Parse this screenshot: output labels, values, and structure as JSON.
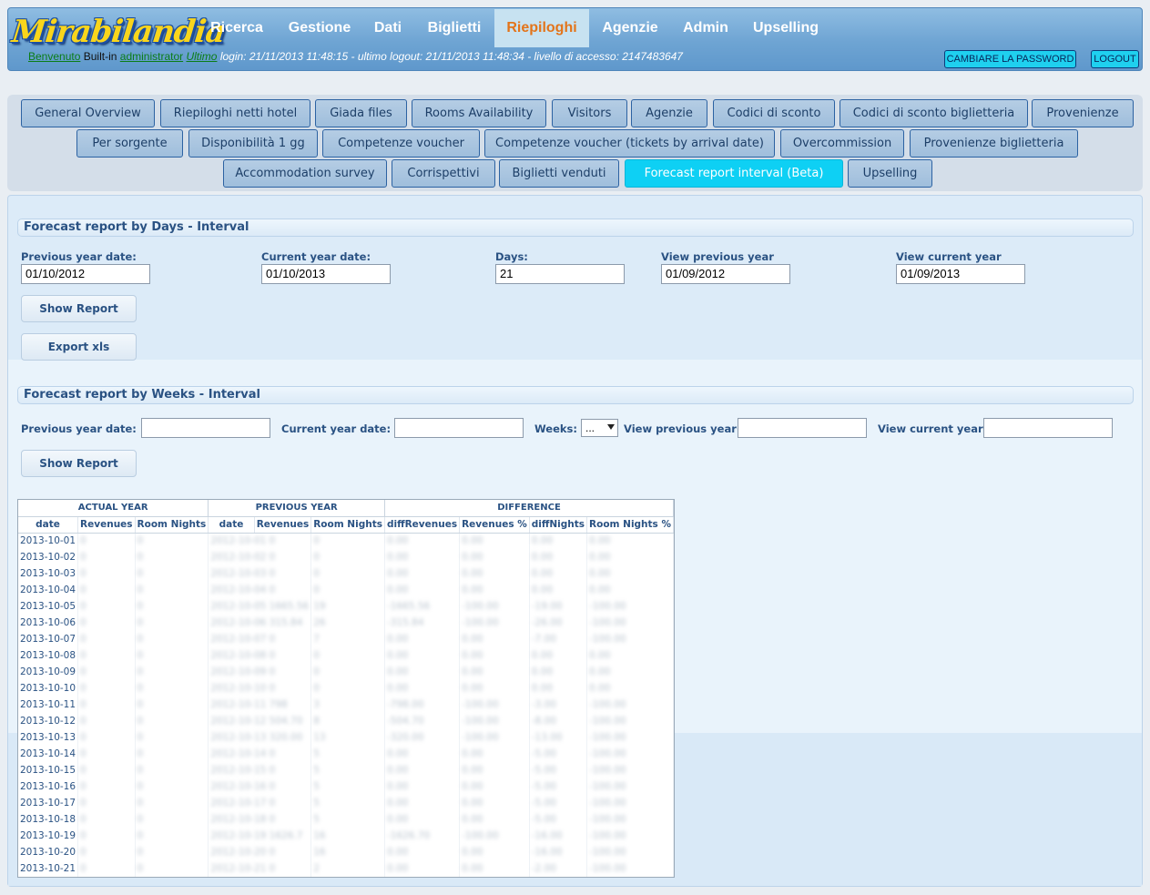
{
  "header": {
    "logo_text": "Mirabilandia",
    "nav": [
      "Ricerca",
      "Gestione",
      "Dati",
      "Biglietti",
      "Riepiloghi",
      "Agenzie",
      "Admin",
      "Upselling"
    ],
    "active_nav": "Riepiloghi",
    "welcome_link": "Benvenuto",
    "builtin_text": "Built-in",
    "user_link": "administrator",
    "ultimo_link": "Ultimo",
    "login_info": "login: 21/11/2013 11:48:15 - ultimo logout: 21/11/2013 11:48:34 - livello di accesso: 2147483647",
    "change_password_label": "CAMBIARE LA PASSWORD",
    "logout_label": "LOGOUT"
  },
  "subnav": {
    "row1": [
      "General Overview",
      "Riepiloghi netti hotel",
      "Giada files",
      "Rooms Availability",
      "Visitors",
      "Agenzie",
      "Codici di sconto",
      "Codici di sconto biglietteria",
      "Provenienze"
    ],
    "row2": [
      "Per sorgente",
      "Disponibilità 1 gg",
      "Competenze voucher",
      "Competenze voucher (tickets by arrival date)",
      "Overcommission",
      "Provenienze biglietteria"
    ],
    "row3": [
      "Accommodation survey",
      "Corrispettivi",
      "Biglietti venduti",
      "Forecast report interval (Beta)",
      "Upselling"
    ],
    "active": "Forecast report interval (Beta)"
  },
  "days_section": {
    "title": "Forecast report by Days - Interval",
    "prev_year_label": "Previous year date:",
    "prev_year_value": "01/10/2012",
    "curr_year_label": "Current year date:",
    "curr_year_value": "01/10/2013",
    "days_label": "Days:",
    "days_value": "21",
    "view_prev_label": "View previous year",
    "view_prev_value": "01/09/2012",
    "view_curr_label": "View current year",
    "view_curr_value": "01/09/2013",
    "show_report_label": "Show Report",
    "export_label": "Export xls"
  },
  "weeks_section": {
    "title": "Forecast report by Weeks - Interval",
    "prev_year_label": "Previous year date:",
    "curr_year_label": "Current year date:",
    "weeks_label": "Weeks:",
    "weeks_value": "...",
    "view_prev_label": "View previous year",
    "view_curr_label": "View current year",
    "show_report_label": "Show Report"
  },
  "report": {
    "group_headers": [
      "ACTUAL YEAR",
      "PREVIOUS YEAR",
      "DIFFERENCE"
    ],
    "columns": [
      "date",
      "Revenues",
      "Room Nights",
      "date",
      "Revenues",
      "Room Nights",
      "diffRevenues",
      "Revenues %",
      "diffNights",
      "Room Nights %"
    ],
    "rows": [
      [
        "2013-10-01",
        "0",
        "0",
        "2012-10-01 0",
        "0",
        "0.00",
        "0.00",
        "0.00",
        "0.00"
      ],
      [
        "2013-10-02",
        "0",
        "0",
        "2012-10-02 0",
        "0",
        "0.00",
        "0.00",
        "0.00",
        "0.00"
      ],
      [
        "2013-10-03",
        "0",
        "0",
        "2012-10-03 0",
        "0",
        "0.00",
        "0.00",
        "0.00",
        "0.00"
      ],
      [
        "2013-10-04",
        "0",
        "0",
        "2012-10-04 0",
        "0",
        "0.00",
        "0.00",
        "0.00",
        "0.00"
      ],
      [
        "2013-10-05",
        "0",
        "0",
        "2012-10-05 1665.56",
        "19",
        "-1665.56",
        "-100.00",
        "-19.00",
        "-100.00"
      ],
      [
        "2013-10-06",
        "0",
        "0",
        "2012-10-06 315.84",
        "26",
        "-315.84",
        "-100.00",
        "-26.00",
        "-100.00"
      ],
      [
        "2013-10-07",
        "0",
        "0",
        "2012-10-07 0",
        "7",
        "0.00",
        "0.00",
        "-7.00",
        "-100.00"
      ],
      [
        "2013-10-08",
        "0",
        "0",
        "2012-10-08 0",
        "0",
        "0.00",
        "0.00",
        "0.00",
        "0.00"
      ],
      [
        "2013-10-09",
        "0",
        "0",
        "2012-10-09 0",
        "0",
        "0.00",
        "0.00",
        "0.00",
        "0.00"
      ],
      [
        "2013-10-10",
        "0",
        "0",
        "2012-10-10 0",
        "0",
        "0.00",
        "0.00",
        "0.00",
        "0.00"
      ],
      [
        "2013-10-11",
        "0",
        "0",
        "2012-10-11 798",
        "3",
        "-798.00",
        "-100.00",
        "-3.00",
        "-100.00"
      ],
      [
        "2013-10-12",
        "0",
        "0",
        "2012-10-12 504.70",
        "8",
        "-504.70",
        "-100.00",
        "-8.00",
        "-100.00"
      ],
      [
        "2013-10-13",
        "0",
        "0",
        "2012-10-13 320.00",
        "13",
        "-320.00",
        "-100.00",
        "-13.00",
        "-100.00"
      ],
      [
        "2013-10-14",
        "0",
        "0",
        "2012-10-14 0",
        "5",
        "0.00",
        "0.00",
        "-5.00",
        "-100.00"
      ],
      [
        "2013-10-15",
        "0",
        "0",
        "2012-10-15 0",
        "5",
        "0.00",
        "0.00",
        "-5.00",
        "-100.00"
      ],
      [
        "2013-10-16",
        "0",
        "0",
        "2012-10-16 0",
        "5",
        "0.00",
        "0.00",
        "-5.00",
        "-100.00"
      ],
      [
        "2013-10-17",
        "0",
        "0",
        "2012-10-17 0",
        "5",
        "0.00",
        "0.00",
        "-5.00",
        "-100.00"
      ],
      [
        "2013-10-18",
        "0",
        "0",
        "2012-10-18 0",
        "5",
        "0.00",
        "0.00",
        "-5.00",
        "-100.00"
      ],
      [
        "2013-10-19",
        "0",
        "0",
        "2012-10-19 1626.7",
        "16",
        "-1626.70",
        "-100.00",
        "-16.00",
        "-100.00"
      ],
      [
        "2013-10-20",
        "0",
        "0",
        "2012-10-20 0",
        "16",
        "0.00",
        "0.00",
        "-16.00",
        "-100.00"
      ],
      [
        "2013-10-21",
        "0",
        "0",
        "2012-10-21 0",
        "2",
        "0.00",
        "0.00",
        "-2.00",
        "-100.00"
      ]
    ]
  }
}
